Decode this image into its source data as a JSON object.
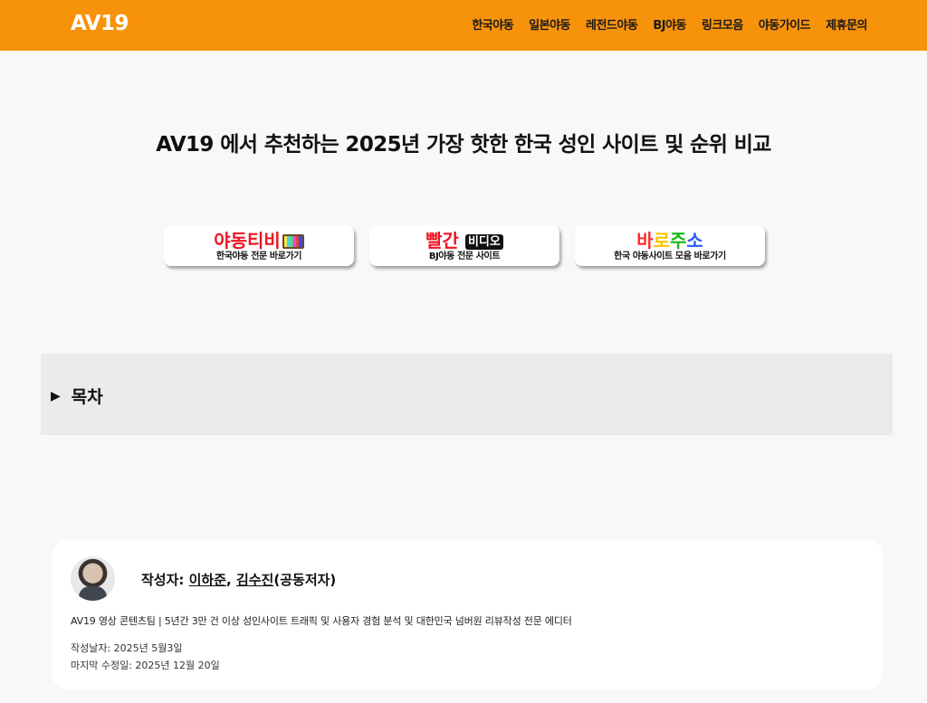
{
  "header": {
    "logo": "AV19",
    "nav": [
      "한국야동",
      "일본야동",
      "레전드야동",
      "BJ야동",
      "링크모음",
      "야동가이드",
      "제휴문의"
    ]
  },
  "main": {
    "title": "AV19 에서 추천하는 2025년 가장 핫한 한국 성인 사이트 및 순위 비교"
  },
  "banners": [
    {
      "brand": "야동티비",
      "sub": "한국야동 전문 바로가기"
    },
    {
      "brand_part1": "빨간",
      "brand_part2": "비디오",
      "sub": "BJ야동 전문 사이트"
    },
    {
      "brand_chars": [
        "바",
        "로",
        "주",
        "소"
      ],
      "sub": "한국 야동사이트 모음 바로가기"
    }
  ],
  "toc": {
    "arrow": "▶",
    "label": "목차"
  },
  "author": {
    "prefix": "작성자: ",
    "name1": "이하준",
    "sep": ", ",
    "name2": "김수진",
    "suffix": "(공동저자)",
    "description": "AV19 영상 콘텐츠팀 | 5년간 3만 건 이상 성인사이트 트래픽 및 사용자 경험 분석 및 대한민국 넘버원 리뷰작성 전문 에디터",
    "written": "작성날자: 2025년 5월3일",
    "modified": "마지막 수정일: 2025년 12월 20일"
  },
  "colors": {
    "header_bg": "#f7920b",
    "page_bg": "#f8f8f8",
    "toc_bg": "#ebebeb"
  }
}
